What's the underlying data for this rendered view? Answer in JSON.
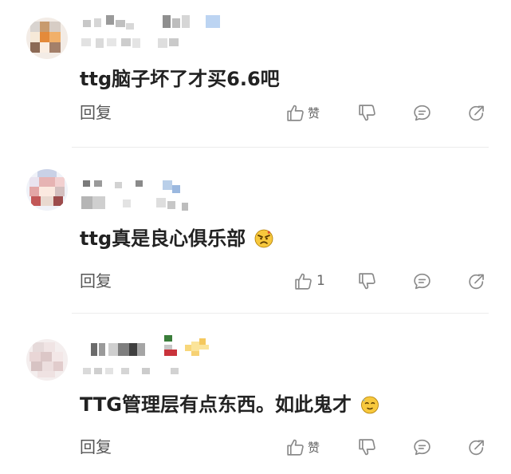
{
  "comments": [
    {
      "text": "ttg脑子坏了才买6.6吧",
      "reply_label": "回复",
      "like_label": "赞",
      "emoji": ""
    },
    {
      "text": "ttg真是良心俱乐部",
      "reply_label": "回复",
      "like_count": "1",
      "emoji": "angry-face-emoji"
    },
    {
      "text": "TTG管理层有点东西。如此鬼才",
      "reply_label": "回复",
      "like_label": "赞",
      "emoji": "sweat-face-emoji"
    }
  ],
  "icons": {
    "like": "thumbs-up-icon",
    "dislike": "thumbs-down-icon",
    "comment": "comment-icon",
    "share": "share-icon"
  },
  "colors": {
    "text": "#222222",
    "secondary_text": "#555555",
    "icon": "#8a8a8a",
    "divider": "#ececec"
  }
}
